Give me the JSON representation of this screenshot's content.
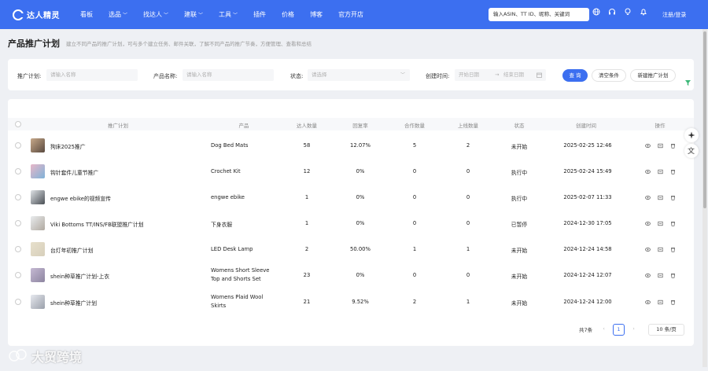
{
  "nav": {
    "brand": "达人精灵",
    "items": [
      {
        "label": "看板",
        "dropdown": false
      },
      {
        "label": "选品",
        "dropdown": true
      },
      {
        "label": "找达人",
        "dropdown": true
      },
      {
        "label": "建联",
        "dropdown": true
      },
      {
        "label": "工具",
        "dropdown": true
      },
      {
        "label": "插件",
        "dropdown": false
      },
      {
        "label": "价格",
        "dropdown": false
      },
      {
        "label": "博客",
        "dropdown": false
      },
      {
        "label": "官方开店",
        "dropdown": false
      }
    ],
    "search_placeholder": "输入ASIN、TT ID、昵称、关键词",
    "login": "注册/登录",
    "icons": [
      "globe-icon",
      "headset-icon",
      "lightbulb-icon",
      "bell-icon"
    ]
  },
  "page": {
    "title": "产品推广计划",
    "description": "建立不同产品的推广计划，可与多个建立任务、邮件关联，了解不同产品的推广节奏，方便管理、查看和总结"
  },
  "filters": {
    "plan_label": "推广计划:",
    "plan_placeholder": "请输入名称",
    "product_label": "产品名称:",
    "product_placeholder": "请输入名称",
    "status_label": "状态:",
    "status_placeholder": "请选择",
    "created_label": "创建时间:",
    "start_placeholder": "开始日期",
    "range_sep": "→",
    "end_placeholder": "结束日期",
    "search_btn": "查 询",
    "clear_btn": "清空条件",
    "new_btn": "新建推广计划"
  },
  "table": {
    "headers": [
      "推广计划",
      "产品",
      "达人数量",
      "回复率",
      "合作数量",
      "上线数量",
      "状态",
      "创建时间",
      "操作"
    ],
    "rows": [
      {
        "plan": "狗床2025推广",
        "product": [
          "Dog Bed Mats"
        ],
        "influencers": "58",
        "reply_rate": "12.07%",
        "coop": "5",
        "online": "2",
        "status": "未开始",
        "created": "2025-02-25 12:46"
      },
      {
        "plan": "钩针套件儿童节推广",
        "product": [
          "Crochet Kit"
        ],
        "influencers": "12",
        "reply_rate": "0%",
        "coop": "0",
        "online": "0",
        "status": "执行中",
        "created": "2025-02-24 15:49"
      },
      {
        "plan": "engwe ebike的视频宣传",
        "product": [
          "engwe ebike"
        ],
        "influencers": "1",
        "reply_rate": "0%",
        "coop": "0",
        "online": "0",
        "status": "执行中",
        "created": "2025-02-07 11:33"
      },
      {
        "plan": "Viki Bottoms TT/INS/FB联盟推广计划",
        "product": [
          "下身衣服"
        ],
        "influencers": "1",
        "reply_rate": "0%",
        "coop": "0",
        "online": "0",
        "status": "已暂停",
        "created": "2024-12-30 17:05"
      },
      {
        "plan": "台灯年初推广计划",
        "product": [
          "LED Desk Lamp"
        ],
        "influencers": "2",
        "reply_rate": "50.00%",
        "coop": "1",
        "online": "1",
        "status": "未开始",
        "created": "2024-12-24 14:58"
      },
      {
        "plan": "shein种草推广计划-上衣",
        "product": [
          "Womens Short Sleeve",
          "Top and Shorts Set"
        ],
        "influencers": "23",
        "reply_rate": "0%",
        "coop": "0",
        "online": "0",
        "status": "未开始",
        "created": "2024-12-24 12:07"
      },
      {
        "plan": "shein种草推广计划",
        "product": [
          "Womens Plaid Wool",
          "Skirts"
        ],
        "influencers": "21",
        "reply_rate": "9.52%",
        "coop": "2",
        "online": "1",
        "status": "未开始",
        "created": "2024-12-24 12:00"
      }
    ]
  },
  "pagination": {
    "total": "共7条",
    "prev": "‹",
    "current": "1",
    "next": "›",
    "page_size": "10 条/页"
  },
  "watermark": "大贸跨境",
  "colors": {
    "brand": "#3c6ff0",
    "page_bg": "#eef0f4"
  }
}
